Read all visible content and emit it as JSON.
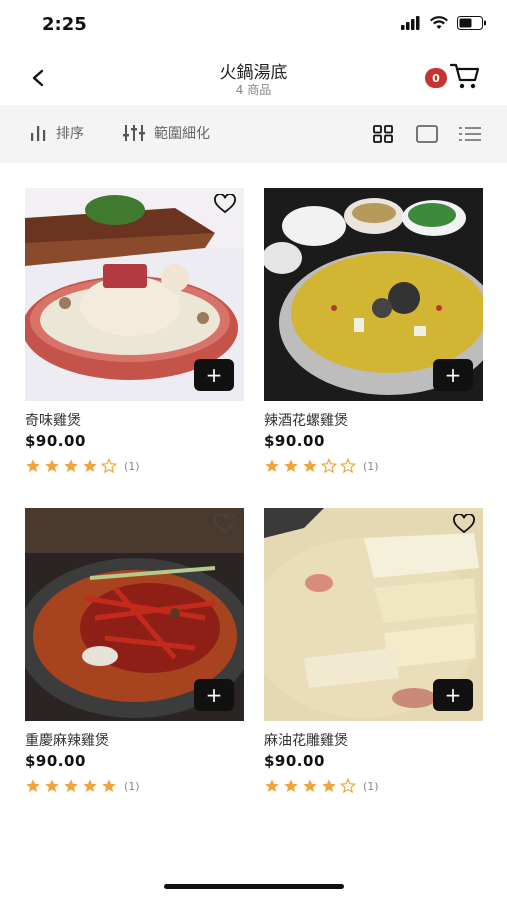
{
  "status": {
    "time": "2:25"
  },
  "nav": {
    "title": "火鍋湯底",
    "subtitle": "4 商品",
    "cart_count": "0"
  },
  "toolbar": {
    "sort_label": "排序",
    "filter_label": "範圍細化"
  },
  "products": [
    {
      "name": "奇味雞煲",
      "price": "$90.00",
      "rating": 4,
      "reviews": "(1)"
    },
    {
      "name": "辣酒花螺雞煲",
      "price": "$90.00",
      "rating": 3,
      "reviews": "(1)"
    },
    {
      "name": "重慶麻辣雞煲",
      "price": "$90.00",
      "rating": 5,
      "reviews": "(1)"
    },
    {
      "name": "麻油花雕雞煲",
      "price": "$90.00",
      "rating": 4,
      "reviews": "(1)"
    }
  ],
  "colors": {
    "star": "#f0a53a",
    "badge": "#c83232",
    "toolbar_bg": "#f4f4f4"
  },
  "icons": [
    "signal-icon",
    "wifi-icon",
    "battery-icon",
    "back-arrow-icon",
    "cart-icon",
    "sort-icon",
    "filter-icon",
    "grid-view-icon",
    "single-view-icon",
    "list-view-icon",
    "heart-icon",
    "plus-icon",
    "star-icon"
  ]
}
